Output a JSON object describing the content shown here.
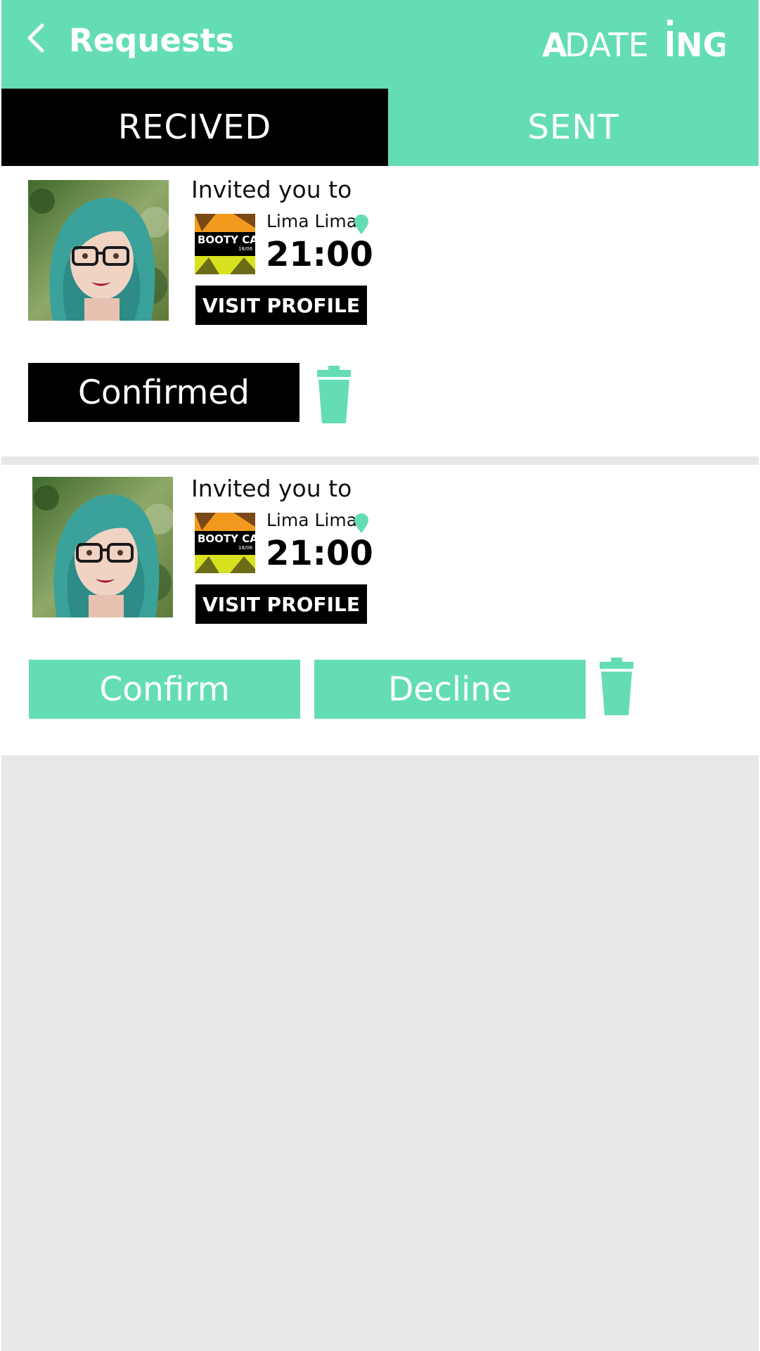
{
  "header": {
    "title": "Requests",
    "brand": "ADATEING",
    "brand_color": "#64ddb6"
  },
  "tabs": [
    {
      "label": "RECIVED",
      "active": true
    },
    {
      "label": "SENT",
      "active": false
    }
  ],
  "requests": [
    {
      "invite_label": "Invited you to",
      "event_image_text": "BOOTY CALL",
      "event_date_text": "18/06",
      "location": "Lima Lima",
      "time": "21:00",
      "visit_profile_label": "VISIT PROFILE",
      "status_label": "Confirmed"
    },
    {
      "invite_label": "Invited you to",
      "event_image_text": "BOOTY CALL",
      "event_date_text": "18/06",
      "location": "Lima Lima",
      "time": "21:00",
      "visit_profile_label": "VISIT PROFILE",
      "confirm_label": "Confirm",
      "decline_label": "Decline"
    }
  ],
  "icons": {
    "back": "chevron-left-icon",
    "pin": "location-pin-icon",
    "trash": "trash-icon"
  }
}
